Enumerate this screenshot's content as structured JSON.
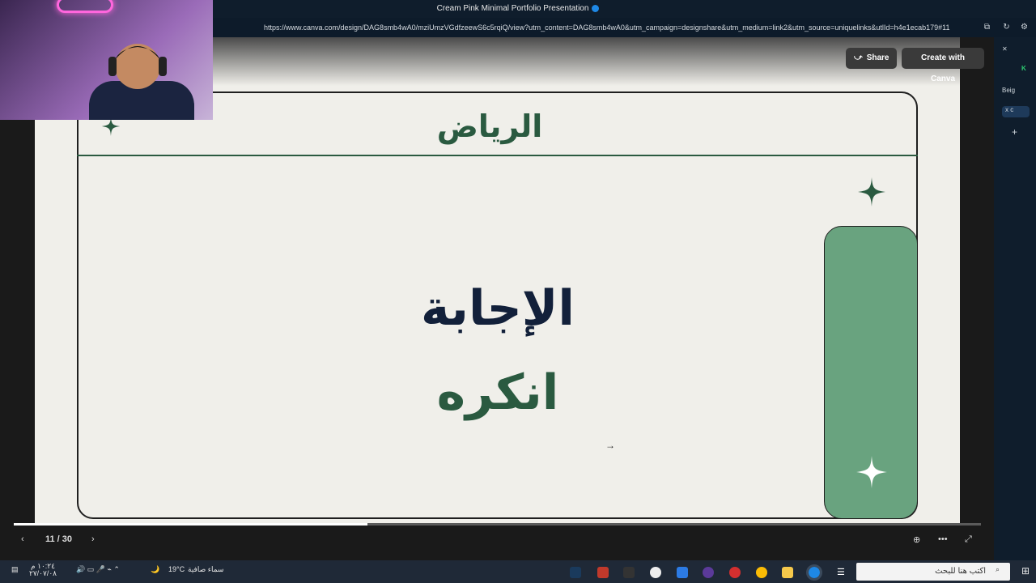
{
  "window": {
    "title": "Cream Pink Minimal Portfolio Presentation"
  },
  "address": {
    "url": "https://www.canva.com/design/DAG8smb4wA0/mziUmzVGdfzeewS6c5rqiQ/view?utm_content=DAG8smb4wA0&utm_campaign=designshare&utm_medium=link2&utm_source=uniquelinks&utlId=h4e1ecab179#11"
  },
  "toolbar": {
    "share_label": "Share",
    "create_label": "Create with Canva"
  },
  "slide": {
    "title": "الرياض",
    "answer_label": "الإجابة",
    "answer_text": "انكره"
  },
  "player": {
    "page_indicator": "11 / 30",
    "progress_fraction": 0.366
  },
  "sidebar": {
    "tab1": "Beig",
    "tab2": "x c"
  },
  "taskbar": {
    "search_placeholder": "اكتب هنا للبحث",
    "weather_text": "سماء صافية",
    "temperature": "19°C",
    "time": "١٠:٢٤ م",
    "date": "٢٧/٠٧/٠٨"
  },
  "colors": {
    "accent_green": "#2a5a40",
    "pill_green": "#69a37f",
    "slide_bg": "#f0efea"
  }
}
